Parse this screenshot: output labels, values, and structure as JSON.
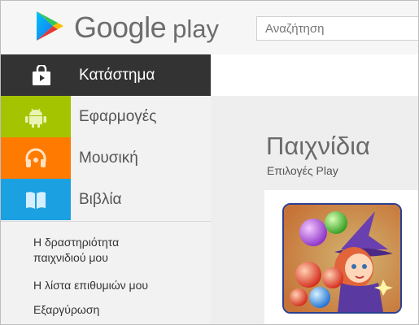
{
  "header": {
    "brand_google": "Google",
    "brand_play": "play",
    "search_placeholder": "Αναζήτηση"
  },
  "sidebar": {
    "store_label": "Κατάστημα",
    "categories": [
      {
        "label": "Εφαρμογές",
        "color": "#a4c400",
        "icon": "android-icon"
      },
      {
        "label": "Μουσική",
        "color": "#ff7a00",
        "icon": "headphones-icon"
      },
      {
        "label": "Βιβλία",
        "color": "#1ba1e2",
        "icon": "book-icon"
      }
    ],
    "links": [
      "Η δραστηριότητα παιχνιδιού μου",
      "Η λίστα επιθυμιών μου",
      "Εξαργύρωση"
    ]
  },
  "main": {
    "title": "Παιχνίδια",
    "subtitle": "Επιλογές Play"
  },
  "colors": {
    "store_bg": "#333333",
    "header_bg": "#f6f6f6",
    "content_bg": "#eeeeee"
  }
}
